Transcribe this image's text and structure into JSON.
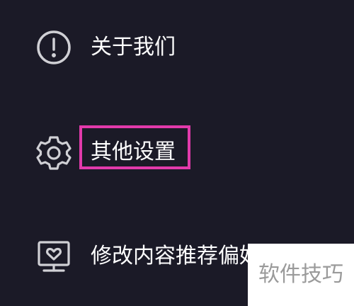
{
  "menu": {
    "items": [
      {
        "label": "关于我们",
        "icon": "info-circle-icon"
      },
      {
        "label": "其他设置",
        "icon": "gear-icon",
        "highlighted": true
      },
      {
        "label": "修改内容推荐偏好",
        "icon": "monitor-heart-icon"
      }
    ]
  },
  "watermark": {
    "text": "软件技巧"
  },
  "colors": {
    "background": "#1b1a27",
    "text": "#ffffff",
    "icon": "#d0d0d5",
    "highlight_border": "#e23aab"
  }
}
